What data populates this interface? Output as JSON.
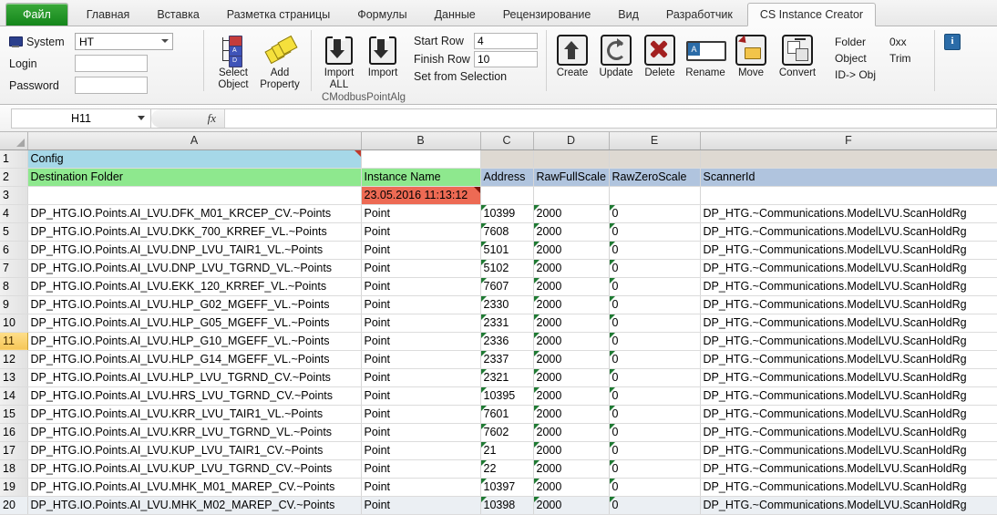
{
  "ribbon_tabs": [
    {
      "label": "Файл",
      "kind": "file"
    },
    {
      "label": "Главная",
      "kind": "normal"
    },
    {
      "label": "Вставка",
      "kind": "normal"
    },
    {
      "label": "Разметка страницы",
      "kind": "normal"
    },
    {
      "label": "Формулы",
      "kind": "normal"
    },
    {
      "label": "Данные",
      "kind": "normal"
    },
    {
      "label": "Рецензирование",
      "kind": "normal"
    },
    {
      "label": "Вид",
      "kind": "normal"
    },
    {
      "label": "Разработчик",
      "kind": "normal"
    },
    {
      "label": "CS Instance Creator",
      "kind": "active"
    }
  ],
  "ribbon": {
    "system_label": "System",
    "system_value": "HT",
    "login_label": "Login",
    "login_value": "",
    "password_label": "Password",
    "password_value": "",
    "select_object_line1": "Select",
    "select_object_line2": "Object",
    "add_property_line1": "Add",
    "add_property_line2": "Property",
    "import_all_line1": "Import",
    "import_all_line2": "ALL",
    "import_line1": "Import",
    "import_line2": "",
    "start_row_label": "Start Row",
    "start_row_value": "4",
    "finish_row_label": "Finish Row",
    "finish_row_value": "10",
    "set_from_selection": "Set from Selection",
    "group_name": "CModbusPointAlg",
    "create_label": "Create",
    "update_label": "Update",
    "delete_label": "Delete",
    "rename_label": "Rename",
    "move_label": "Move",
    "convert_label": "Convert",
    "folder_label": "Folder",
    "oxx_label": "0xx",
    "object_label": "Object",
    "trim_label": "Trim",
    "id_to_obj_label": "ID-> Obj",
    "info_glyph": "i",
    "rename_icon_letter": "A"
  },
  "formula_bar": {
    "name_box": "H11",
    "fx_label": "fx",
    "formula_value": ""
  },
  "grid": {
    "column_headers": [
      "A",
      "B",
      "C",
      "D",
      "E",
      "F"
    ],
    "rows": [
      {
        "num": "1",
        "selected": false,
        "kind": "config",
        "cells": [
          "Config",
          "",
          "",
          "",
          "",
          ""
        ]
      },
      {
        "num": "2",
        "selected": false,
        "kind": "header",
        "cells": [
          "Destination Folder",
          "Instance Name",
          "Address",
          "RawFullScale",
          "RawZeroScale",
          "ScannerId"
        ]
      },
      {
        "num": "3",
        "selected": false,
        "kind": "stamp",
        "cells": [
          "",
          "23.05.2016 11:13:12",
          "",
          "",
          "",
          ""
        ]
      },
      {
        "num": "4",
        "selected": false,
        "kind": "data",
        "cells": [
          "DP_HTG.IO.Points.AI_LVU.DFK_M01_KRCEP_CV.~Points",
          "Point",
          "10399",
          "2000",
          "0",
          "DP_HTG.~Communications.ModelLVU.ScanHoldRg"
        ]
      },
      {
        "num": "5",
        "selected": false,
        "kind": "data",
        "cells": [
          "DP_HTG.IO.Points.AI_LVU.DKK_700_KRREF_VL.~Points",
          "Point",
          "7608",
          "2000",
          "0",
          "DP_HTG.~Communications.ModelLVU.ScanHoldRg"
        ]
      },
      {
        "num": "6",
        "selected": false,
        "kind": "data",
        "cells": [
          "DP_HTG.IO.Points.AI_LVU.DNP_LVU_TAIR1_VL.~Points",
          "Point",
          "5101",
          "2000",
          "0",
          "DP_HTG.~Communications.ModelLVU.ScanHoldRg"
        ]
      },
      {
        "num": "7",
        "selected": false,
        "kind": "data",
        "cells": [
          "DP_HTG.IO.Points.AI_LVU.DNP_LVU_TGRND_VL.~Points",
          "Point",
          "5102",
          "2000",
          "0",
          "DP_HTG.~Communications.ModelLVU.ScanHoldRg"
        ]
      },
      {
        "num": "8",
        "selected": false,
        "kind": "data",
        "cells": [
          "DP_HTG.IO.Points.AI_LVU.EKK_120_KRREF_VL.~Points",
          "Point",
          "7607",
          "2000",
          "0",
          "DP_HTG.~Communications.ModelLVU.ScanHoldRg"
        ]
      },
      {
        "num": "9",
        "selected": false,
        "kind": "data",
        "cells": [
          "DP_HTG.IO.Points.AI_LVU.HLP_G02_MGEFF_VL.~Points",
          "Point",
          "2330",
          "2000",
          "0",
          "DP_HTG.~Communications.ModelLVU.ScanHoldRg"
        ]
      },
      {
        "num": "10",
        "selected": false,
        "kind": "data",
        "cells": [
          "DP_HTG.IO.Points.AI_LVU.HLP_G05_MGEFF_VL.~Points",
          "Point",
          "2331",
          "2000",
          "0",
          "DP_HTG.~Communications.ModelLVU.ScanHoldRg"
        ]
      },
      {
        "num": "11",
        "selected": true,
        "kind": "data",
        "cells": [
          "DP_HTG.IO.Points.AI_LVU.HLP_G10_MGEFF_VL.~Points",
          "Point",
          "2336",
          "2000",
          "0",
          "DP_HTG.~Communications.ModelLVU.ScanHoldRg"
        ]
      },
      {
        "num": "12",
        "selected": false,
        "kind": "data",
        "cells": [
          "DP_HTG.IO.Points.AI_LVU.HLP_G14_MGEFF_VL.~Points",
          "Point",
          "2337",
          "2000",
          "0",
          "DP_HTG.~Communications.ModelLVU.ScanHoldRg"
        ]
      },
      {
        "num": "13",
        "selected": false,
        "kind": "data",
        "cells": [
          "DP_HTG.IO.Points.AI_LVU.HLP_LVU_TGRND_CV.~Points",
          "Point",
          "2321",
          "2000",
          "0",
          "DP_HTG.~Communications.ModelLVU.ScanHoldRg"
        ]
      },
      {
        "num": "14",
        "selected": false,
        "kind": "data",
        "cells": [
          "DP_HTG.IO.Points.AI_LVU.HRS_LVU_TGRND_CV.~Points",
          "Point",
          "10395",
          "2000",
          "0",
          "DP_HTG.~Communications.ModelLVU.ScanHoldRg"
        ]
      },
      {
        "num": "15",
        "selected": false,
        "kind": "data",
        "cells": [
          "DP_HTG.IO.Points.AI_LVU.KRR_LVU_TAIR1_VL.~Points",
          "Point",
          "7601",
          "2000",
          "0",
          "DP_HTG.~Communications.ModelLVU.ScanHoldRg"
        ]
      },
      {
        "num": "16",
        "selected": false,
        "kind": "data",
        "cells": [
          "DP_HTG.IO.Points.AI_LVU.KRR_LVU_TGRND_VL.~Points",
          "Point",
          "7602",
          "2000",
          "0",
          "DP_HTG.~Communications.ModelLVU.ScanHoldRg"
        ]
      },
      {
        "num": "17",
        "selected": false,
        "kind": "data",
        "cells": [
          "DP_HTG.IO.Points.AI_LVU.KUP_LVU_TAIR1_CV.~Points",
          "Point",
          "21",
          "2000",
          "0",
          "DP_HTG.~Communications.ModelLVU.ScanHoldRg"
        ]
      },
      {
        "num": "18",
        "selected": false,
        "kind": "data",
        "cells": [
          "DP_HTG.IO.Points.AI_LVU.KUP_LVU_TGRND_CV.~Points",
          "Point",
          "22",
          "2000",
          "0",
          "DP_HTG.~Communications.ModelLVU.ScanHoldRg"
        ]
      },
      {
        "num": "19",
        "selected": false,
        "kind": "data",
        "cells": [
          "DP_HTG.IO.Points.AI_LVU.MHK_M01_MAREP_CV.~Points",
          "Point",
          "10397",
          "2000",
          "0",
          "DP_HTG.~Communications.ModelLVU.ScanHoldRg"
        ]
      },
      {
        "num": "20",
        "selected": false,
        "kind": "data",
        "cells": [
          "DP_HTG.IO.Points.AI_LVU.MHK_M02_MAREP_CV.~Points",
          "Point",
          "10398",
          "2000",
          "0",
          "DP_HTG.~Communications.ModelLVU.ScanHoldRg"
        ]
      }
    ]
  },
  "colors": {
    "file_tab_green": "#14861b",
    "config_blue": "#a6d8e8",
    "header_green": "#8ee88e",
    "header_blue": "#b0c4de",
    "timestamp_red": "#ed6a54",
    "selected_row_header": "#f5c658"
  }
}
